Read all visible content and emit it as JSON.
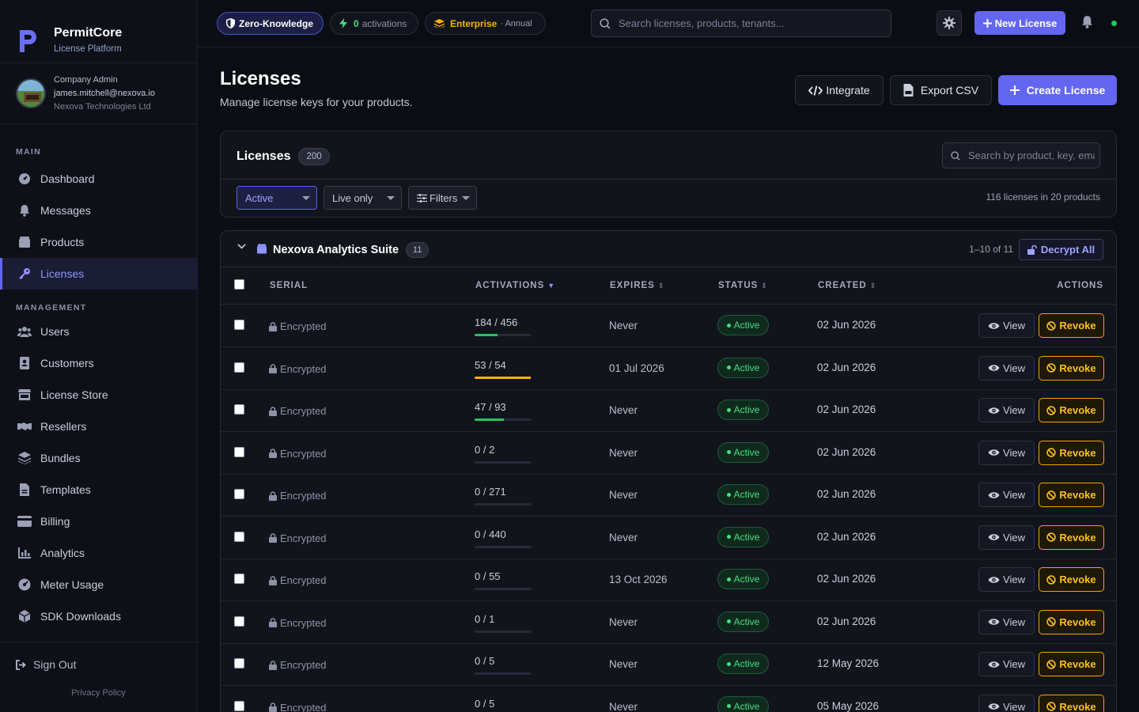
{
  "brand": {
    "name": "PermitCore",
    "subtitle": "License Platform"
  },
  "user": {
    "role": "Company Admin",
    "email": "james.mitchell@nexova.io",
    "org": "Nexova Technologies Ltd"
  },
  "sidebar": {
    "main_label": "MAIN",
    "main_items": [
      {
        "label": "Dashboard",
        "icon": "dashboard-icon"
      },
      {
        "label": "Messages",
        "icon": "bell-icon"
      },
      {
        "label": "Products",
        "icon": "box-icon"
      },
      {
        "label": "Licenses",
        "icon": "key-icon",
        "active": true
      }
    ],
    "management_label": "MANAGEMENT",
    "management_items": [
      {
        "label": "Users",
        "icon": "users-icon"
      },
      {
        "label": "Customers",
        "icon": "address-book-icon"
      },
      {
        "label": "License Store",
        "icon": "store-icon"
      },
      {
        "label": "Resellers",
        "icon": "handshake-icon"
      },
      {
        "label": "Bundles",
        "icon": "layers-icon"
      },
      {
        "label": "Templates",
        "icon": "file-icon"
      },
      {
        "label": "Billing",
        "icon": "credit-card-icon"
      },
      {
        "label": "Analytics",
        "icon": "chart-icon"
      },
      {
        "label": "Meter Usage",
        "icon": "gauge-icon"
      },
      {
        "label": "SDK Downloads",
        "icon": "cube-icon"
      }
    ],
    "signout": "Sign Out",
    "privacy": "Privacy Policy"
  },
  "topbar": {
    "zk_label": "Zero-Knowledge",
    "activations_count": "0",
    "activations_label": "activations",
    "plan_label": "Enterprise",
    "plan_period": "· Annual",
    "search_placeholder": "Search licenses, products, tenants...",
    "new_license": "New License"
  },
  "page": {
    "title": "Licenses",
    "subtitle": "Manage license keys for your products.",
    "integrate": "Integrate",
    "export": "Export CSV",
    "create": "Create License"
  },
  "list_header": {
    "title": "Licenses",
    "count": "200",
    "search_placeholder": "Search by product, key, email...",
    "filter_status": "Active",
    "filter_mode": "Live only",
    "filters_label": "Filters",
    "summary": "116 licenses in 20 products"
  },
  "group": {
    "name": "Nexova Analytics Suite",
    "count": "11",
    "range": "1–10 of 11",
    "decrypt_all": "Decrypt All"
  },
  "table": {
    "columns": {
      "serial": "SERIAL",
      "activations": "ACTIVATIONS",
      "expires": "EXPIRES",
      "status": "STATUS",
      "created": "CREATED",
      "actions": "ACTIONS"
    },
    "view_label": "View",
    "revoke_label": "Revoke",
    "rows": [
      {
        "serial": "Encrypted",
        "activations": "184 / 456",
        "usage": 0.4,
        "level": "ok",
        "expires": "Never",
        "status": "Active",
        "created": "02 Jun 2026"
      },
      {
        "serial": "Encrypted",
        "activations": "53 / 54",
        "usage": 0.98,
        "level": "warn",
        "expires": "01 Jul 2026",
        "status": "Active",
        "created": "02 Jun 2026"
      },
      {
        "serial": "Encrypted",
        "activations": "47 / 93",
        "usage": 0.51,
        "level": "ok",
        "expires": "Never",
        "status": "Active",
        "created": "02 Jun 2026"
      },
      {
        "serial": "Encrypted",
        "activations": "0 / 2",
        "usage": 0,
        "level": "ok",
        "expires": "Never",
        "status": "Active",
        "created": "02 Jun 2026"
      },
      {
        "serial": "Encrypted",
        "activations": "0 / 271",
        "usage": 0,
        "level": "ok",
        "expires": "Never",
        "status": "Active",
        "created": "02 Jun 2026"
      },
      {
        "serial": "Encrypted",
        "activations": "0 / 440",
        "usage": 0,
        "level": "ok",
        "expires": "Never",
        "status": "Active",
        "created": "02 Jun 2026"
      },
      {
        "serial": "Encrypted",
        "activations": "0 / 55",
        "usage": 0,
        "level": "ok",
        "expires": "13 Oct 2026",
        "status": "Active",
        "created": "02 Jun 2026"
      },
      {
        "serial": "Encrypted",
        "activations": "0 / 1",
        "usage": 0,
        "level": "ok",
        "expires": "Never",
        "status": "Active",
        "created": "02 Jun 2026"
      },
      {
        "serial": "Encrypted",
        "activations": "0 / 5",
        "usage": 0,
        "level": "ok",
        "expires": "Never",
        "status": "Active",
        "created": "12 May 2026"
      },
      {
        "serial": "Encrypted",
        "activations": "0 / 5",
        "usage": 0,
        "level": "ok",
        "expires": "Never",
        "status": "Active",
        "created": "05 May 2026"
      }
    ]
  },
  "colors": {
    "accent": "#6366f1",
    "success": "#22c55e",
    "warning": "#f5b301",
    "background": "#0b0d14"
  }
}
